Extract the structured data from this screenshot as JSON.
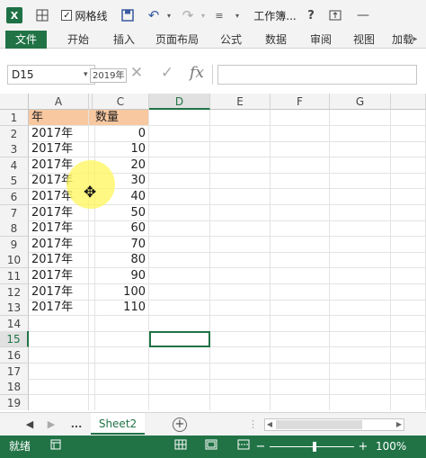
{
  "qat": {
    "app_icon": "X",
    "gridlines_label": "网格线",
    "window_title": "工作簿...",
    "help": "?",
    "icons": [
      "excel-logo-icon",
      "grid-icon",
      "checkbox-icon",
      "save-icon",
      "undo-icon",
      "redo-icon",
      "customize-icon",
      "help-icon",
      "restore-icon",
      "minimize-icon"
    ]
  },
  "ribbon": {
    "tabs": [
      "文件",
      "开始",
      "插入",
      "页面布局",
      "公式",
      "数据",
      "审阅",
      "视图",
      "加载"
    ],
    "active_tab": "文件",
    "accent_color": "#217346"
  },
  "formula_bar": {
    "name_box": "D15",
    "autocomplete_text": "2019年",
    "formula_value": ""
  },
  "sheet": {
    "columns": [
      "A",
      "B",
      "C",
      "D",
      "E",
      "F",
      "G"
    ],
    "selected_column": "D",
    "selected_row": "15",
    "rows": [
      "1",
      "2",
      "3",
      "4",
      "5",
      "6",
      "7",
      "8",
      "9",
      "10",
      "11",
      "12",
      "13",
      "14",
      "15",
      "16",
      "17",
      "18",
      "19"
    ],
    "header_row": {
      "a": "年",
      "c": "数量"
    },
    "data": [
      {
        "a": "2017年",
        "c": "0"
      },
      {
        "a": "2017年",
        "c": "10"
      },
      {
        "a": "2017年",
        "c": "20"
      },
      {
        "a": "2017年",
        "c": "30"
      },
      {
        "a": "2017年",
        "c": "40"
      },
      {
        "a": "2017年",
        "c": "50"
      },
      {
        "a": "2017年",
        "c": "60"
      },
      {
        "a": "2017年",
        "c": "70"
      },
      {
        "a": "2017年",
        "c": "80"
      },
      {
        "a": "2017年",
        "c": "90"
      },
      {
        "a": "2017年",
        "c": "100"
      },
      {
        "a": "2017年",
        "c": "110"
      }
    ],
    "header_fill": "#f8c8a0"
  },
  "sheet_tabs": {
    "ellipsis": "...",
    "active_sheet": "Sheet2",
    "add_label": "+"
  },
  "status_bar": {
    "status_text": "就绪",
    "zoom_level": "100%",
    "zoom_minus": "−",
    "zoom_plus": "+"
  }
}
